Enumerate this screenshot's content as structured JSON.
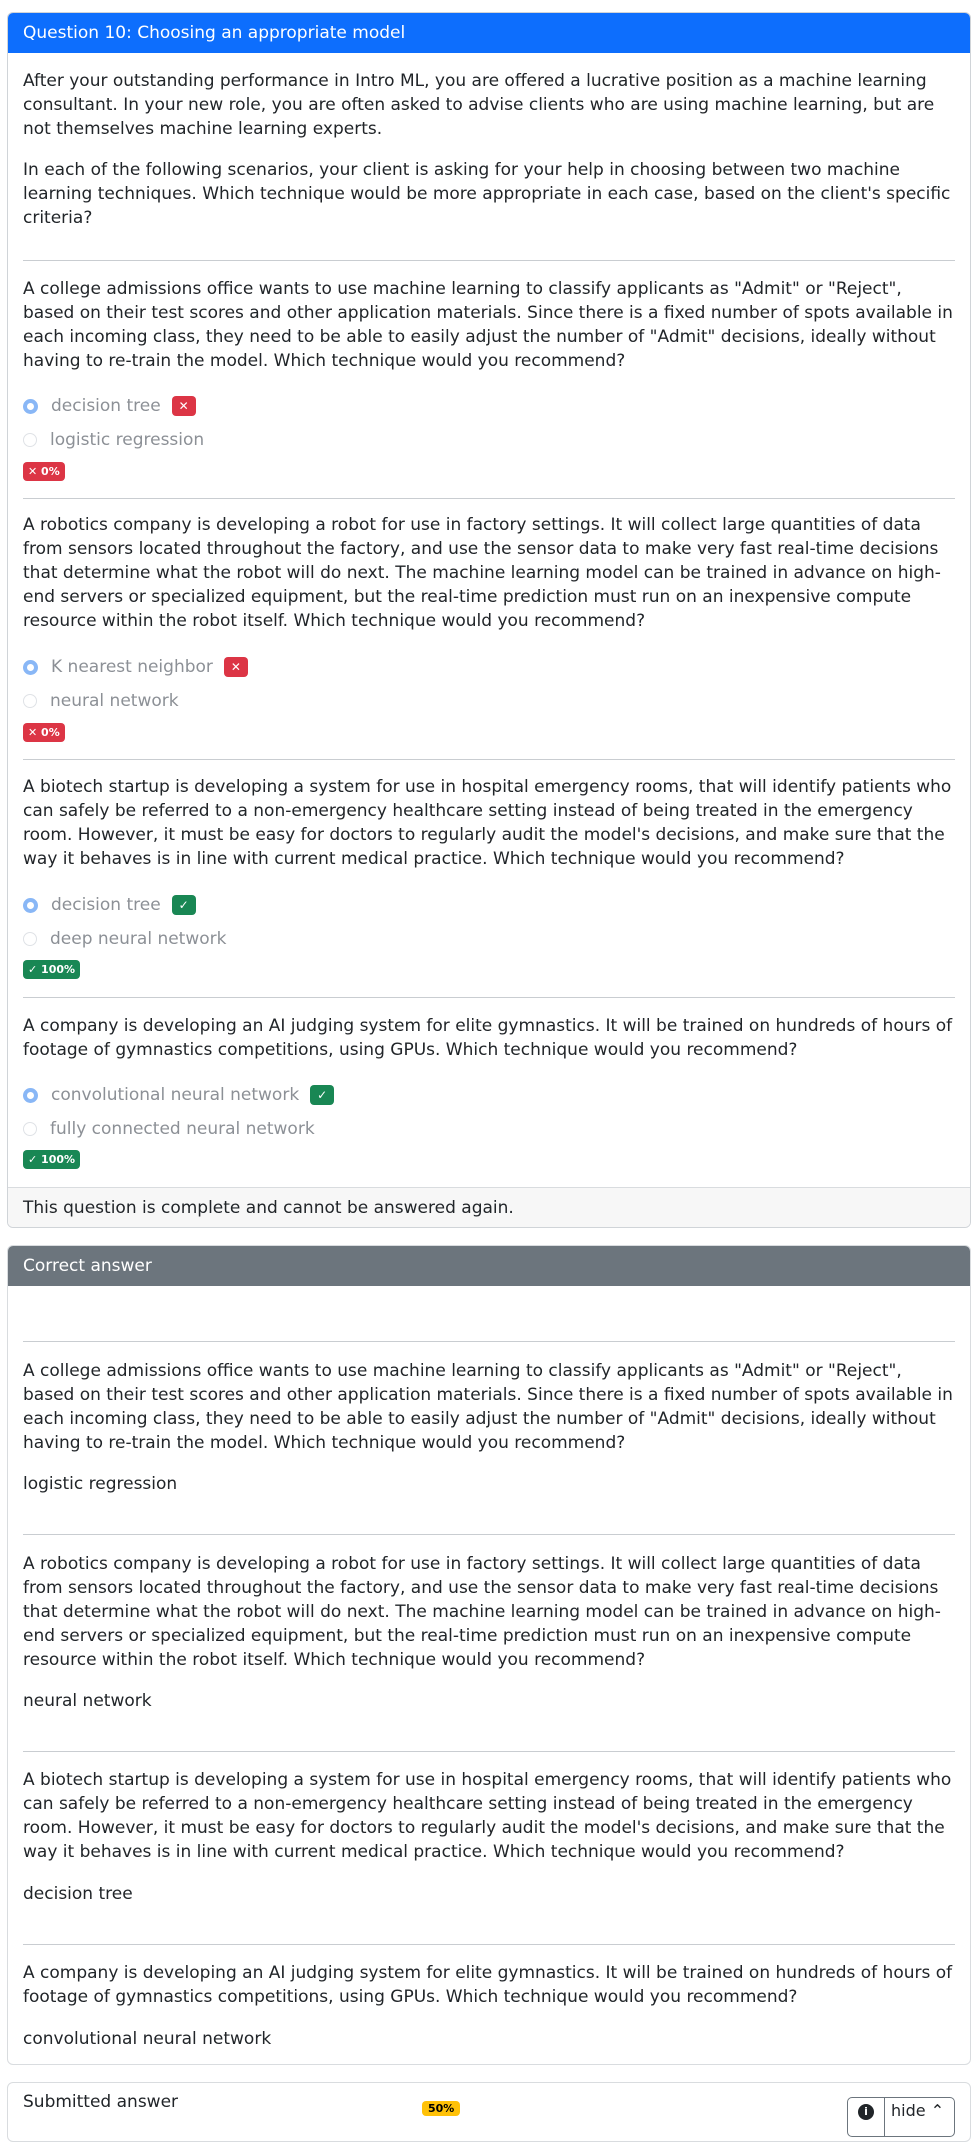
{
  "question": {
    "title": "Question 10: Choosing an appropriate model",
    "intro1": "After your outstanding performance in Intro ML, you are offered a lucrative position as a machine learning consultant. In your new role, you are often asked to advise clients who are using machine learning, but are not themselves machine learning experts.",
    "intro2": "In each of the following scenarios, your client is asking for your help in choosing between two machine learning techniques. Which technique would be more appropriate in each case, based on the client's specific criteria?",
    "parts": [
      {
        "text": "A college admissions office wants to use machine learning to classify applicants as \"Admit\" or \"Reject\", based on their test scores and other application materials. Since there is a fixed number of spots available in each incoming class, they need to be able to easily adjust the number of \"Admit\" decisions, ideally without having to re-train the model. Which technique would you recommend?",
        "options": [
          "decision tree",
          "logistic regression"
        ],
        "selected": 0,
        "correct": false,
        "score": "0%"
      },
      {
        "text": "A robotics company is developing a robot for use in factory settings. It will collect large quantities of data from sensors located throughout the factory, and use the sensor data to make very fast real-time decisions that determine what the robot will do next. The machine learning model can be trained in advance on high-end servers or specialized equipment, but the real-time prediction must run on an inexpensive compute resource within the robot itself. Which technique would you recommend?",
        "options": [
          "K nearest neighbor",
          "neural network"
        ],
        "selected": 0,
        "correct": false,
        "score": "0%"
      },
      {
        "text": "A biotech startup is developing a system for use in hospital emergency rooms, that will identify patients who can safely be referred to a non-emergency healthcare setting instead of being treated in the emergency room. However, it must be easy for doctors to regularly audit the model's decisions, and make sure that the way it behaves is in line with current medical practice. Which technique would you recommend?",
        "options": [
          "decision tree",
          "deep neural network"
        ],
        "selected": 0,
        "correct": true,
        "score": "100%"
      },
      {
        "text": "A company is developing an AI judging system for elite gymnastics. It will be trained on hundreds of hours of footage of gymnastics competitions, using GPUs. Which technique would you recommend?",
        "options": [
          "convolutional neural network",
          "fully connected neural network"
        ],
        "selected": 0,
        "correct": true,
        "score": "100%"
      }
    ],
    "footer": "This question is complete and cannot be answered again."
  },
  "correct_answer": {
    "title": "Correct answer",
    "answers": [
      "logistic regression",
      "neural network",
      "decision tree",
      "convolutional neural network"
    ]
  },
  "submitted": {
    "title": "Submitted answer",
    "score": "50%",
    "hide_label": "hide",
    "info_icon": "info-icon"
  },
  "colors": {
    "primary": "#0d6efd",
    "danger": "#dc3545",
    "success": "#198754",
    "secondary": "#6c757d",
    "warning": "#ffc107"
  }
}
